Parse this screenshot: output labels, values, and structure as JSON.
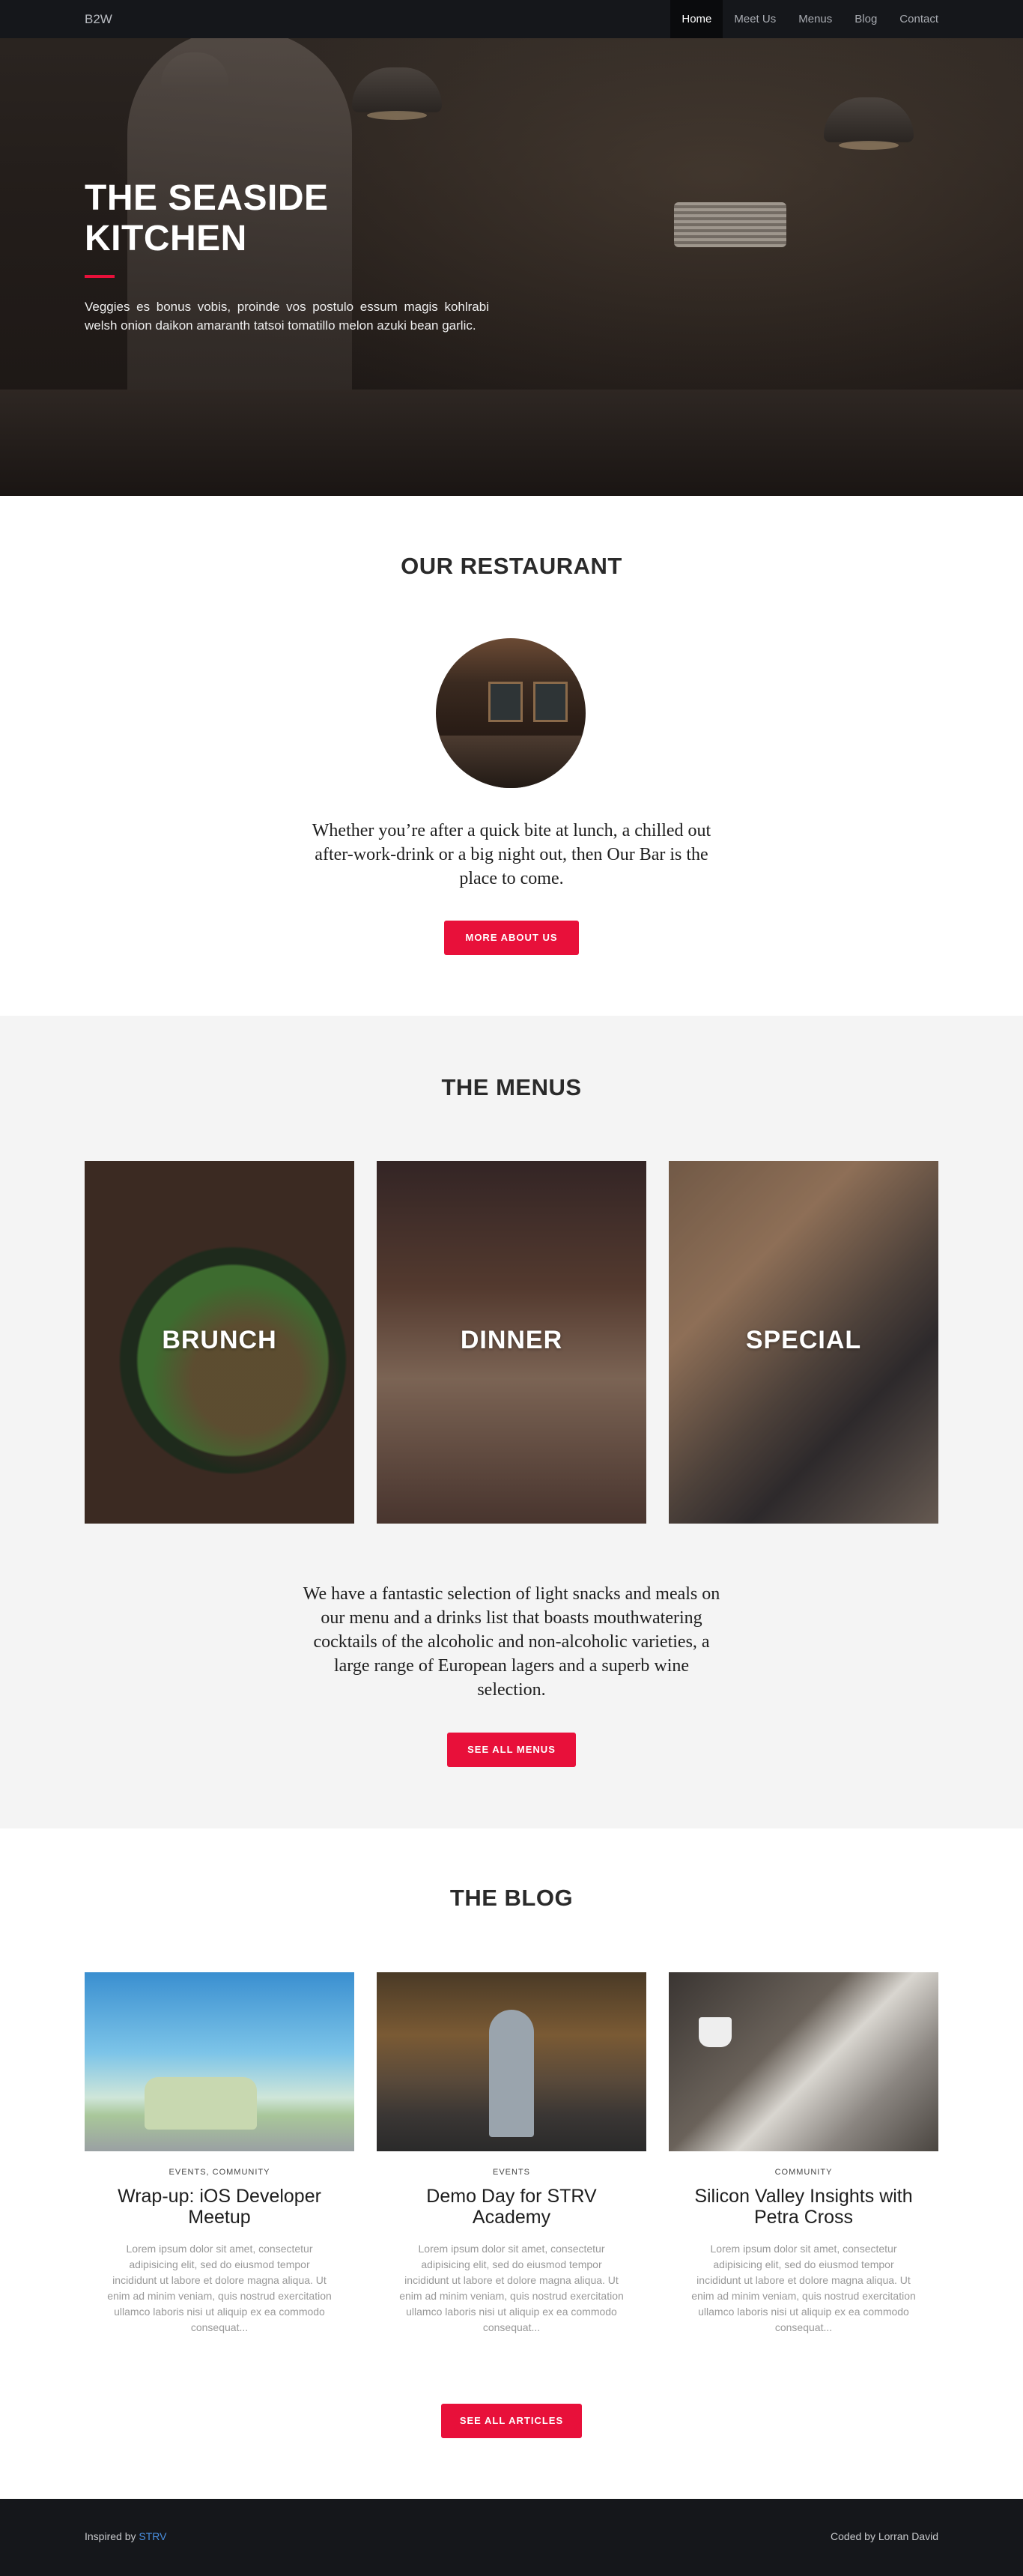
{
  "nav": {
    "brand": "B2W",
    "items": [
      {
        "label": "Home",
        "active": true
      },
      {
        "label": "Meet Us",
        "active": false
      },
      {
        "label": "Menus",
        "active": false
      },
      {
        "label": "Blog",
        "active": false
      },
      {
        "label": "Contact",
        "active": false
      }
    ]
  },
  "hero": {
    "title_line1": "THE SEASIDE",
    "title_line2": "KITCHEN",
    "text": "Veggies es bonus vobis, proinde vos postulo essum magis kohlrabi welsh onion daikon amaranth tatsoi tomatillo melon azuki bean garlic.",
    "accent": "#e8103a"
  },
  "restaurant": {
    "title": "OUR RESTAURANT",
    "quote": "Whether you’re after a quick bite at lunch, a chilled out after-work-drink or a big night out, then Our Bar is the place to come.",
    "button": "MORE ABOUT US"
  },
  "menus": {
    "title": "THE MENUS",
    "cards": [
      {
        "label": "BRUNCH"
      },
      {
        "label": "DINNER"
      },
      {
        "label": "SPECIAL"
      }
    ],
    "text": "We have a fantastic selection of light snacks and meals on our menu and a drinks list that boasts mouthwatering cocktails of the alcoholic and non-alcoholic varieties, a large range of European lagers and a superb wine selection.",
    "button": "SEE ALL MENUS"
  },
  "blog": {
    "title": "THE BLOG",
    "posts": [
      {
        "category": "EVENTS, COMMUNITY",
        "title": "Wrap-up: iOS Developer Meetup",
        "excerpt": "Lorem ipsum dolor sit amet, consectetur adipisicing elit, sed do eiusmod tempor incididunt ut labore et dolore magna aliqua. Ut enim ad minim veniam, quis nostrud exercitation ullamco laboris nisi ut aliquip ex ea commodo consequat..."
      },
      {
        "category": "EVENTS",
        "title": "Demo Day for STRV Academy",
        "excerpt": "Lorem ipsum dolor sit amet, consectetur adipisicing elit, sed do eiusmod tempor incididunt ut labore et dolore magna aliqua. Ut enim ad minim veniam, quis nostrud exercitation ullamco laboris nisi ut aliquip ex ea commodo consequat..."
      },
      {
        "category": "COMMUNITY",
        "title": "Silicon Valley Insights with Petra Cross",
        "excerpt": "Lorem ipsum dolor sit amet, consectetur adipisicing elit, sed do eiusmod tempor incididunt ut labore et dolore magna aliqua. Ut enim ad minim veniam, quis nostrud exercitation ullamco laboris nisi ut aliquip ex ea commodo consequat..."
      }
    ],
    "button": "SEE ALL ARTICLES"
  },
  "footer": {
    "inspired_prefix": "Inspired by",
    "inspired_link": "STRV",
    "credit": "Coded by Lorran David"
  }
}
